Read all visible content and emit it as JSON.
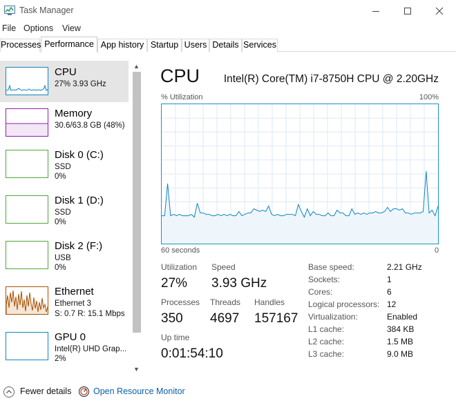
{
  "window": {
    "title": "Task Manager",
    "controls": [
      "minimize",
      "maximize",
      "close"
    ]
  },
  "menu": [
    "File",
    "Options",
    "View"
  ],
  "tabs": [
    "Processes",
    "Performance",
    "App history",
    "Startup",
    "Users",
    "Details",
    "Services"
  ],
  "active_tab": "Performance",
  "sidebar": [
    {
      "title": "CPU",
      "line1": "27%  3.93 GHz",
      "line2": "",
      "color": "#1184c1",
      "selected": true
    },
    {
      "title": "Memory",
      "line1": "30.6/63.8 GB (48%)",
      "line2": "",
      "color": "#8b1fa9",
      "selected": false
    },
    {
      "title": "Disk 0 (C:)",
      "line1": "SSD",
      "line2": "0%",
      "color": "#4da73a",
      "selected": false
    },
    {
      "title": "Disk 1 (D:)",
      "line1": "SSD",
      "line2": "0%",
      "color": "#4da73a",
      "selected": false
    },
    {
      "title": "Disk 2 (F:)",
      "line1": "USB",
      "line2": "0%",
      "color": "#4da73a",
      "selected": false
    },
    {
      "title": "Ethernet",
      "line1": "Ethernet 3",
      "line2": "S:  0.7  R:  15.1 Mbps",
      "color": "#a74f01",
      "selected": false
    },
    {
      "title": "GPU 0",
      "line1": "Intel(R) UHD Grap...",
      "line2": "2%",
      "color": "#1184c1",
      "selected": false
    }
  ],
  "cpu": {
    "heading": "CPU",
    "model": "Intel(R) Core(TM) i7-8750H CPU @ 2.20GHz",
    "graph_top_left": "% Utilization",
    "graph_top_right": "100%",
    "graph_bottom_left": "60 seconds",
    "graph_bottom_right": "0",
    "utilization_label": "Utilization",
    "utilization": "27%",
    "speed_label": "Speed",
    "speed": "3.93 GHz",
    "processes_label": "Processes",
    "processes": "350",
    "threads_label": "Threads",
    "threads": "4697",
    "handles_label": "Handles",
    "handles": "157167",
    "uptime_label": "Up time",
    "uptime": "0:01:54:10",
    "info": [
      {
        "label": "Base speed:",
        "value": "2.21 GHz"
      },
      {
        "label": "Sockets:",
        "value": "1"
      },
      {
        "label": "Cores:",
        "value": "6"
      },
      {
        "label": "Logical processors:",
        "value": "12"
      },
      {
        "label": "Virtualization:",
        "value": "Enabled"
      },
      {
        "label": "L1 cache:",
        "value": "384 KB"
      },
      {
        "label": "L2 cache:",
        "value": "1.5 MB"
      },
      {
        "label": "L3 cache:",
        "value": "9.0 MB"
      }
    ]
  },
  "chart_data": {
    "type": "area",
    "ylim": [
      0,
      100
    ],
    "xlim": [
      60,
      0
    ],
    "values": [
      20,
      20,
      43,
      20,
      21,
      20,
      21,
      20,
      20,
      20,
      21,
      19,
      29,
      22,
      22,
      21,
      21,
      20,
      20,
      21,
      20,
      21,
      20,
      21,
      20,
      20,
      23,
      20,
      21,
      22,
      22,
      25,
      24,
      23,
      24,
      23,
      27,
      21,
      20,
      21,
      20,
      20,
      21,
      21,
      21,
      20,
      28,
      23,
      19,
      25,
      20,
      23,
      21,
      21,
      20,
      20,
      22,
      20,
      20,
      24,
      22,
      22,
      20,
      20,
      25,
      21,
      22,
      21,
      22,
      21,
      22,
      22,
      23,
      22,
      22,
      23,
      26,
      23,
      25,
      25,
      24,
      25,
      22,
      22,
      21,
      22,
      22,
      22,
      23,
      52,
      22,
      24,
      20,
      27
    ]
  },
  "footer": {
    "fewer_details": "Fewer details",
    "open_monitor": "Open Resource Monitor"
  }
}
